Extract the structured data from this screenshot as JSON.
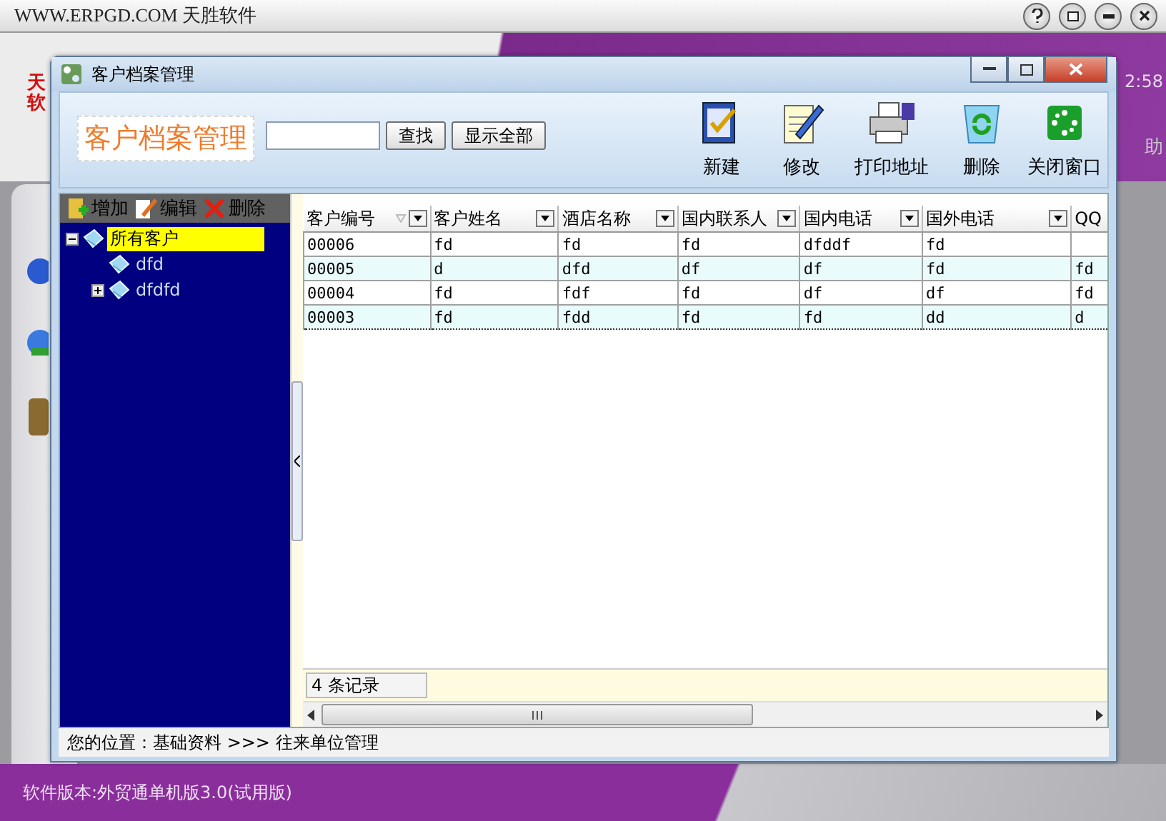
{
  "app": {
    "title": "WWW.ERPGD.COM 天胜软件",
    "logo_chars": [
      "天",
      "软"
    ],
    "clock": "2:58",
    "menu_hint": "助",
    "version": "软件版本:外贸通单机版3.0(试用版)"
  },
  "dialog": {
    "title": "客户档案管理",
    "banner": "客户档案管理",
    "search_buttons": [
      "查找",
      "显示全部"
    ],
    "toolbar": [
      {
        "kind": "new",
        "label": "新建"
      },
      {
        "kind": "edit",
        "label": "修改"
      },
      {
        "kind": "print",
        "label": "打印地址"
      },
      {
        "kind": "delete",
        "label": "删除"
      },
      {
        "kind": "close",
        "label": "关闭窗口"
      }
    ],
    "tree_actions": [
      {
        "kind": "add",
        "label": "增加"
      },
      {
        "kind": "edit",
        "label": "编辑"
      },
      {
        "kind": "delete",
        "label": "删除"
      }
    ],
    "tree": {
      "label": "所有客户",
      "selected": true,
      "expanded": true,
      "children": [
        {
          "label": "dfd",
          "selected": false
        },
        {
          "label": "dfdfd",
          "selected": false,
          "expanded": false
        }
      ]
    },
    "table": {
      "columns": [
        {
          "label": "客户编号",
          "sorted": true
        },
        {
          "label": "客户姓名",
          "sorted": false
        },
        {
          "label": "酒店名称",
          "sorted": false
        },
        {
          "label": "国内联系人",
          "sorted": false
        },
        {
          "label": "国内电话",
          "sorted": false
        },
        {
          "label": "国外电话",
          "sorted": false
        },
        {
          "label": "QQ"
        }
      ],
      "rows": [
        {
          "selected": false,
          "cells": [
            "00006",
            "fd",
            "fd",
            "fd",
            "dfddf",
            "fd",
            null
          ]
        },
        {
          "selected": false,
          "cells": [
            "00005",
            "d",
            "dfd",
            "df",
            "df",
            "fd",
            "fd"
          ]
        },
        {
          "selected": false,
          "cells": [
            "00004",
            "fd",
            "fdf",
            "fd",
            "df",
            "df",
            "fd"
          ]
        },
        {
          "selected": true,
          "cells": [
            "00003",
            "fd",
            "fdd",
            "fd",
            "fd",
            "dd",
            "d"
          ]
        }
      ]
    },
    "record_count": "4 条记录",
    "breadcrumb": "您的位置：基础资料 >>> 往来单位管理"
  }
}
